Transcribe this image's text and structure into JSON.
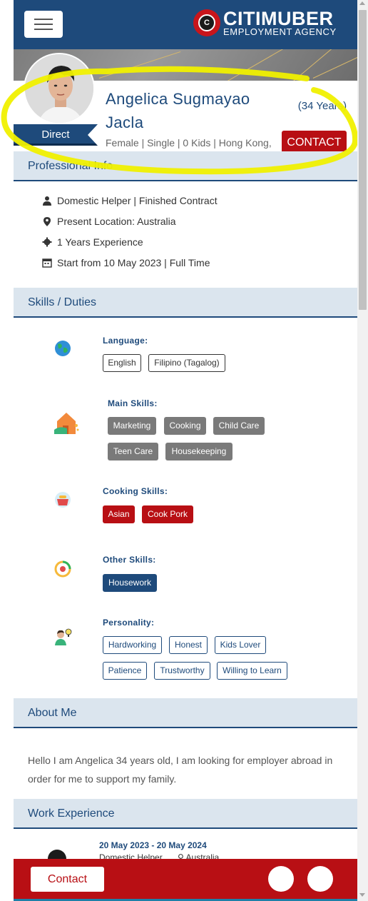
{
  "header": {
    "brand_title": "CITIMUBER",
    "brand_subtitle": "EMPLOYMENT AGENCY",
    "logo_glyph": "C",
    "menu_icon": "hamburger-icon",
    "brand_color": "#1e4a7b",
    "accent_color": "#b80f14"
  },
  "profile": {
    "name": "Angelica Sugmayao Jacla",
    "age": "(34 Years)",
    "direct_label": "Direct",
    "meta": "Female | Single | 0 Kids | Hong Kong,",
    "contact_label": "CONTACT"
  },
  "professional": {
    "title": "Professional Info",
    "rows": [
      {
        "icon": "user-icon",
        "text": "Domestic Helper | Finished Contract"
      },
      {
        "icon": "map-pin-icon",
        "text": "Present Location: Australia"
      },
      {
        "icon": "gear-icon",
        "text": "1 Years Experience"
      },
      {
        "icon": "calendar-icon",
        "text": "Start from 10 May 2023 | Full Time"
      }
    ]
  },
  "skills": {
    "title": "Skills / Duties",
    "language": {
      "label": "Language:",
      "icon": "globe-icon",
      "items": [
        "English",
        "Filipino (Tagalog)"
      ]
    },
    "main": {
      "label": "Main Skills:",
      "icon": "house-care-icon",
      "items": [
        "Marketing",
        "Cooking",
        "Child Care",
        "Teen Care",
        "Housekeeping"
      ]
    },
    "cooking": {
      "label": "Cooking Skills:",
      "icon": "cooking-pot-icon",
      "items": [
        "Asian",
        "Cook Pork"
      ]
    },
    "other": {
      "label": "Other Skills:",
      "icon": "skills-badge-icon",
      "items": [
        "Housework"
      ]
    },
    "personality": {
      "label": "Personality:",
      "icon": "person-idea-icon",
      "items": [
        "Hardworking",
        "Honest",
        "Kids Lover",
        "Patience",
        "Trustworthy",
        "Willing to Learn"
      ]
    }
  },
  "about": {
    "title": "About Me",
    "text": "Hello I am Angelica 34 years old, I am looking for employer abroad in order for me to support my family."
  },
  "work": {
    "title": "Work Experience",
    "entries": [
      {
        "date": "20 May 2023 - 20 May 2024",
        "role": "Domestic Helper",
        "location": "Australia",
        "icon": "gear-icon"
      }
    ]
  },
  "bottom_bar": {
    "contact_label": "Contact",
    "button_icons": [
      "whatsapp-icon",
      "phone-icon"
    ]
  }
}
